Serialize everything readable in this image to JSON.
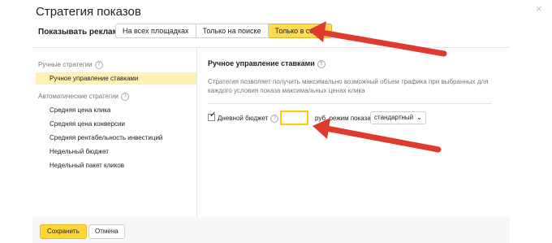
{
  "dialog": {
    "title": "Стратегия показов",
    "close_glyph": "×"
  },
  "show_ads": {
    "label": "Показывать рекламу:",
    "options": [
      "На всех площадках",
      "Только на поиске",
      "Только в сетях"
    ],
    "selected": "Только в сетях"
  },
  "sidebar": {
    "manual_header": "Ручные стратегии",
    "manual_items": [
      "Ручное управление ставками"
    ],
    "auto_header": "Автоматические стратегии",
    "auto_items": [
      "Средняя цена клика",
      "Средняя цена конверсии",
      "Средняя рентабельность инвестиций",
      "Недельный бюджет",
      "Недельный пакет кликов"
    ]
  },
  "main": {
    "heading": "Ручное управление ставками",
    "description": "Стратегия позволяет получить максимально возможный объем трафика при выбранных для каждого условия показа максимальных ценах клика",
    "daily_budget": {
      "checked": true,
      "label": "Дневной бюджет",
      "value": "",
      "currency_label": "руб. режим показа",
      "mode_value": "стандартный",
      "mode_chevron": "⌄"
    }
  },
  "footer": {
    "save_label": "Сохранить",
    "cancel_label": "Отмена"
  },
  "colors": {
    "accent": "#ffdb4d",
    "active_item_bg": "#fff0b3",
    "arrow": "#e03a2e"
  }
}
